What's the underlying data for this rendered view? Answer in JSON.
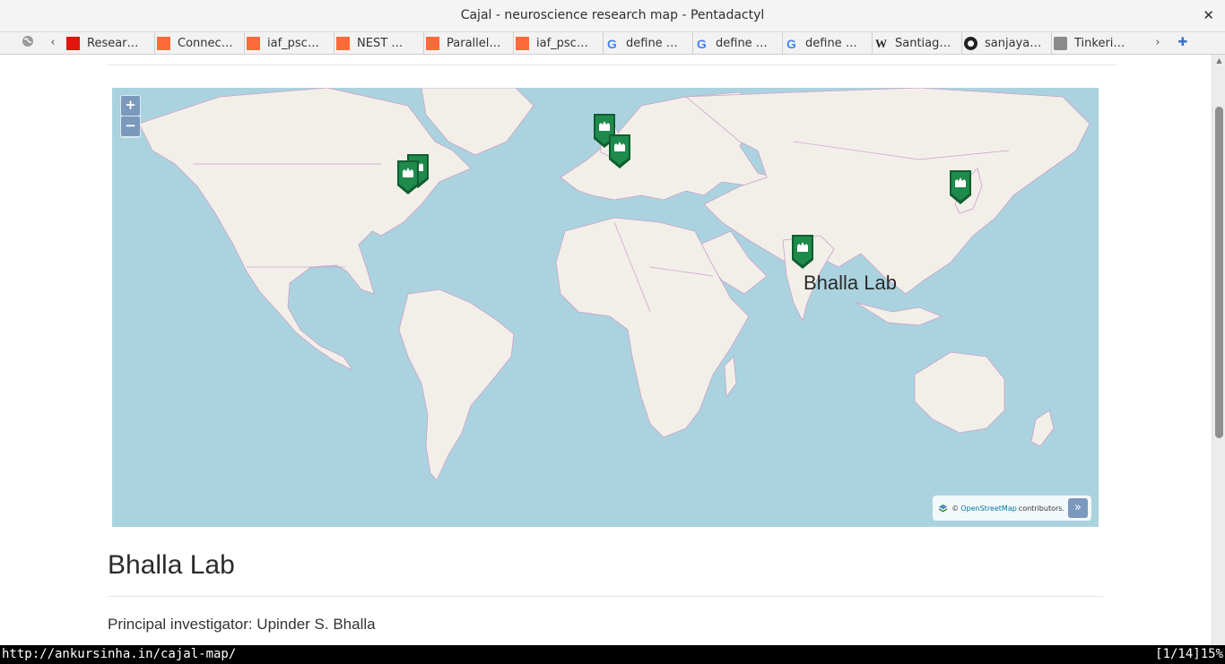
{
  "window": {
    "title": "Cajal - neuroscience research map - Pentadactyl"
  },
  "tabs": [
    {
      "label": "Resear…",
      "favicon": "red-square"
    },
    {
      "label": "Connec…",
      "favicon": "orange-square"
    },
    {
      "label": "iaf_psc…",
      "favicon": "orange-square"
    },
    {
      "label": "NEST …",
      "favicon": "orange-square"
    },
    {
      "label": "Parallel…",
      "favicon": "orange-square"
    },
    {
      "label": "iaf_psc…",
      "favicon": "orange-square"
    },
    {
      "label": "define …",
      "favicon": "google-g"
    },
    {
      "label": "define …",
      "favicon": "google-g"
    },
    {
      "label": "define …",
      "favicon": "google-g"
    },
    {
      "label": "Santiag…",
      "favicon": "wikipedia-w"
    },
    {
      "label": "sanjaya…",
      "favicon": "github-octocat"
    },
    {
      "label": "Tinkeri…",
      "favicon": "avatar"
    }
  ],
  "map": {
    "zoom_in": "+",
    "zoom_out": "−",
    "popup_label": "Bhalla Lab",
    "attribution": {
      "prefix": "©",
      "link": "OpenStreetMap",
      "suffix": "contributors.",
      "expand": "»"
    },
    "colors": {
      "water": "#abd3df",
      "land": "#f2efe9",
      "marker": "#1e8a4c",
      "marker_dark": "#0f5e2f",
      "borders": "#c9a1c9"
    },
    "marker_icon": "research-institute-icon"
  },
  "lab": {
    "name": "Bhalla Lab",
    "pi_text": "Principal investigator: Upinder S. Bhalla"
  },
  "status": {
    "url": "http://ankursinha.in/cajal-map/",
    "position": "[1/14]15%"
  }
}
